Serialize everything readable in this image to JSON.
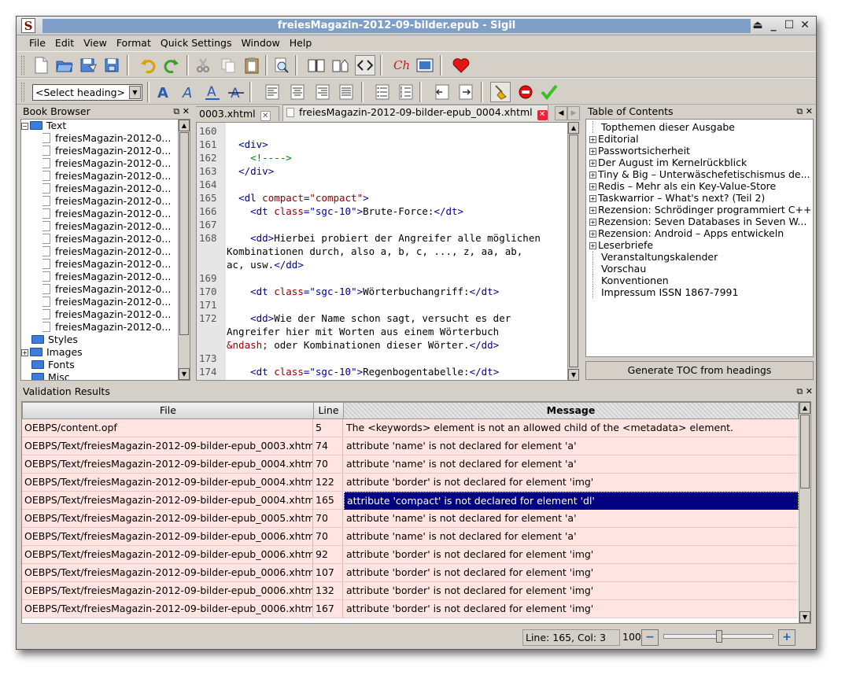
{
  "window": {
    "title": "freiesMagazin-2012-09-bilder.epub - Sigil",
    "icon_letter": "S"
  },
  "menu": [
    "File",
    "Edit",
    "View",
    "Format",
    "Quick Settings",
    "Window",
    "Help"
  ],
  "toolbar": {
    "heading_select": "<Select heading>",
    "row1_icons": [
      "new-file-icon",
      "open-folder-icon",
      "save-icon",
      "save-as-icon",
      "undo-icon",
      "redo-icon",
      "cut-icon",
      "copy-icon",
      "paste-icon",
      "find-replace-icon",
      "book-view-icon",
      "split-view-icon",
      "code-view-icon",
      "spellcheck-icon",
      "insert-image-icon",
      "donate-heart-icon"
    ],
    "row2_icons": [
      "bold-icon",
      "italic-icon",
      "underline-icon",
      "strikethrough-icon",
      "align-left-icon",
      "align-center-icon",
      "align-right-icon",
      "justify-icon",
      "bullet-list-icon",
      "numbered-list-icon",
      "decrease-indent-icon",
      "increase-indent-icon",
      "clean-source-icon",
      "stop-validation-icon",
      "validate-check-icon"
    ]
  },
  "book_browser": {
    "title": "Book Browser",
    "folders": {
      "text": "Text",
      "styles": "Styles",
      "images": "Images",
      "fonts": "Fonts",
      "misc": "Misc"
    },
    "files": [
      "freiesMagazin-2012-0...",
      "freiesMagazin-2012-0...",
      "freiesMagazin-2012-0...",
      "freiesMagazin-2012-0...",
      "freiesMagazin-2012-0...",
      "freiesMagazin-2012-0...",
      "freiesMagazin-2012-0...",
      "freiesMagazin-2012-0...",
      "freiesMagazin-2012-0...",
      "freiesMagazin-2012-0...",
      "freiesMagazin-2012-0...",
      "freiesMagazin-2012-0...",
      "freiesMagazin-2012-0...",
      "freiesMagazin-2012-0...",
      "freiesMagazin-2012-0...",
      "freiesMagazin-2012-0..."
    ]
  },
  "tabs": [
    {
      "label": "0003.xhtml"
    },
    {
      "label": "freiesMagazin-2012-09-bilder-epub_0004.xhtml"
    }
  ],
  "code_lines": [
    {
      "n": "160",
      "html": ""
    },
    {
      "n": "161",
      "html": "  <span class='t'>&lt;div&gt;</span>"
    },
    {
      "n": "162",
      "html": "    <span class='com'>&lt;!----&gt;</span>"
    },
    {
      "n": "163",
      "html": "  <span class='t'>&lt;/div&gt;</span>"
    },
    {
      "n": "164",
      "html": ""
    },
    {
      "n": "165",
      "html": "  <span class='t'>&lt;dl</span> <span class='av'>compact</span><span class='t'>=</span><span class='av'>\"compact\"</span><span class='t'>&gt;</span>",
      "hl": true
    },
    {
      "n": "166",
      "html": "    <span class='t'>&lt;dt</span> <span class='av'>class</span><span class='t'>=\"sgc-10\"&gt;</span>Brute-Force:<span class='t'>&lt;/dt&gt;</span>"
    },
    {
      "n": "167",
      "html": ""
    },
    {
      "n": "168",
      "html": "    <span class='t'>&lt;dd&gt;</span>Hierbei probiert der Angreifer alle möglichen"
    },
    {
      "n": "",
      "html": "Kombinationen durch, also a, b, c, ..., z, aa, ab,"
    },
    {
      "n": "",
      "html": "ac, usw.<span class='t'>&lt;/dd&gt;</span>"
    },
    {
      "n": "169",
      "html": ""
    },
    {
      "n": "170",
      "html": "    <span class='t'>&lt;dt</span> <span class='av'>class</span><span class='t'>=\"sgc-10\"&gt;</span>Wörterbuchangriff:<span class='t'>&lt;/dt&gt;</span>"
    },
    {
      "n": "171",
      "html": ""
    },
    {
      "n": "172",
      "html": "    <span class='t'>&lt;dd&gt;</span>Wie der Name schon sagt, versucht es der"
    },
    {
      "n": "",
      "html": "Angreifer hier mit Worten aus einem Wörterbuch"
    },
    {
      "n": "",
      "html": "<span class='ent'>&amp;ndash;</span> oder Kombinationen dieser Wörter.<span class='t'>&lt;/dd&gt;</span>"
    },
    {
      "n": "173",
      "html": ""
    },
    {
      "n": "174",
      "html": "    <span class='t'>&lt;dt</span> <span class='av'>class</span><span class='t'>=\"sgc-10\"&gt;</span>Regenbogentabelle:<span class='t'>&lt;/dt&gt;</span>"
    }
  ],
  "toc": {
    "title": "Table of Contents",
    "items": [
      {
        "label": "Topthemen dieser Ausgabe",
        "expandable": false
      },
      {
        "label": "Editorial",
        "expandable": true
      },
      {
        "label": "Passwortsicherheit",
        "expandable": true
      },
      {
        "label": "Der August im Kernelrückblick",
        "expandable": true
      },
      {
        "label": "Tiny & Big – Unterwäschefetischismus de...",
        "expandable": true
      },
      {
        "label": "Redis – Mehr als ein Key-Value-Store",
        "expandable": true
      },
      {
        "label": "Taskwarrior – What's next? (Teil 2)",
        "expandable": true
      },
      {
        "label": "Rezension: Schrödinger programmiert C++",
        "expandable": true
      },
      {
        "label": "Rezension: Seven Databases in Seven W...",
        "expandable": true
      },
      {
        "label": "Rezension: Android – Apps entwickeln",
        "expandable": true
      },
      {
        "label": "Leserbriefe",
        "expandable": true
      },
      {
        "label": "Veranstaltungskalender",
        "expandable": false
      },
      {
        "label": "Vorschau",
        "expandable": false
      },
      {
        "label": "Konventionen",
        "expandable": false
      },
      {
        "label": "Impressum ISSN 1867-7991",
        "expandable": false
      }
    ],
    "generate_button": "Generate TOC from headings"
  },
  "validation": {
    "title": "Validation Results",
    "headers": {
      "file": "File",
      "line": "Line",
      "message": "Message"
    },
    "rows": [
      {
        "file": "OEBPS/content.opf",
        "line": "5",
        "message": "The <keywords> element is not an allowed child of the <metadata> element."
      },
      {
        "file": "OEBPS/Text/freiesMagazin-2012-09-bilder-epub_0003.xhtml",
        "line": "74",
        "message": "attribute 'name' is not declared for element 'a'"
      },
      {
        "file": "OEBPS/Text/freiesMagazin-2012-09-bilder-epub_0004.xhtml",
        "line": "70",
        "message": "attribute 'name' is not declared for element 'a'"
      },
      {
        "file": "OEBPS/Text/freiesMagazin-2012-09-bilder-epub_0004.xhtml",
        "line": "122",
        "message": "attribute 'border' is not declared for element 'img'"
      },
      {
        "file": "OEBPS/Text/freiesMagazin-2012-09-bilder-epub_0004.xhtml",
        "line": "165",
        "message": "attribute 'compact' is not declared for element 'dl'",
        "selected": true
      },
      {
        "file": "OEBPS/Text/freiesMagazin-2012-09-bilder-epub_0005.xhtml",
        "line": "70",
        "message": "attribute 'name' is not declared for element 'a'"
      },
      {
        "file": "OEBPS/Text/freiesMagazin-2012-09-bilder-epub_0006.xhtml",
        "line": "70",
        "message": "attribute 'name' is not declared for element 'a'"
      },
      {
        "file": "OEBPS/Text/freiesMagazin-2012-09-bilder-epub_0006.xhtml",
        "line": "92",
        "message": "attribute 'border' is not declared for element 'img'"
      },
      {
        "file": "OEBPS/Text/freiesMagazin-2012-09-bilder-epub_0006.xhtml",
        "line": "107",
        "message": "attribute 'border' is not declared for element 'img'"
      },
      {
        "file": "OEBPS/Text/freiesMagazin-2012-09-bilder-epub_0006.xhtml",
        "line": "132",
        "message": "attribute 'border' is not declared for element 'img'"
      },
      {
        "file": "OEBPS/Text/freiesMagazin-2012-09-bilder-epub_0006.xhtml",
        "line": "167",
        "message": "attribute 'border' is not declared for element 'img'"
      }
    ]
  },
  "status": {
    "position": "Line: 165, Col: 3",
    "zoom": "100%",
    "zoom_out": "−",
    "zoom_in": "+",
    "zoom_slider_level": 0.5
  }
}
